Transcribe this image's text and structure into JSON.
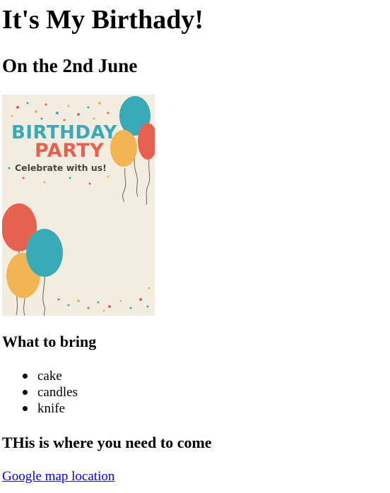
{
  "page": {
    "title": "It's My Birthady!",
    "date_heading": "On the 2nd June"
  },
  "flyer": {
    "line1": "BIRTHDAY",
    "line2": "PARTY",
    "line3": "Celebrate with us!",
    "colors": {
      "background": "#f3ece0",
      "teal": "#3aa9b8",
      "coral": "#e8604f",
      "yellow": "#f2b553",
      "text_dark": "#4a4540"
    }
  },
  "bring": {
    "heading": "What to bring",
    "items": [
      "cake",
      "candles",
      "knife"
    ]
  },
  "location": {
    "heading": "THis is where you need to come",
    "link_text": "Google map location",
    "link_color": "#0000ee"
  }
}
